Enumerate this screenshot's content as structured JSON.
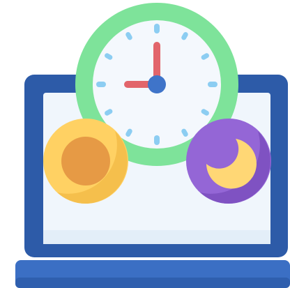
{
  "illustration": {
    "subject": "laptop-day-night-clock-icon",
    "clock": {
      "hour_hand_points_to": 12,
      "minute_hand_points_to": 9,
      "tick_count": 12
    },
    "colors": {
      "laptop_frame": "#2d5ba8",
      "laptop_base": "#3b6fc4",
      "laptop_base_shadow": "#2f5fae",
      "screen": "#f0f6fc",
      "screen_shade": "#e3eef8",
      "clock_ring": "#7ee39a",
      "clock_ring_shade": "#68d385",
      "clock_face": "#f4f8fd",
      "clock_face_shade": "#e6f0fa",
      "clock_ticks": "#8ccdf2",
      "hour_hand": "#e2656b",
      "minute_hand": "#e2656b",
      "clock_center": "#3f74c9",
      "sun_outer": "#ffd163",
      "sun_outer_shade": "#f5bf4c",
      "sun_core": "#e69a45",
      "moon_circle": "#9466d6",
      "moon_circle_shade": "#7f52c2",
      "moon": "#ffd775"
    },
    "icons": [
      "laptop-icon",
      "clock-icon",
      "sun-icon",
      "moon-icon"
    ]
  }
}
